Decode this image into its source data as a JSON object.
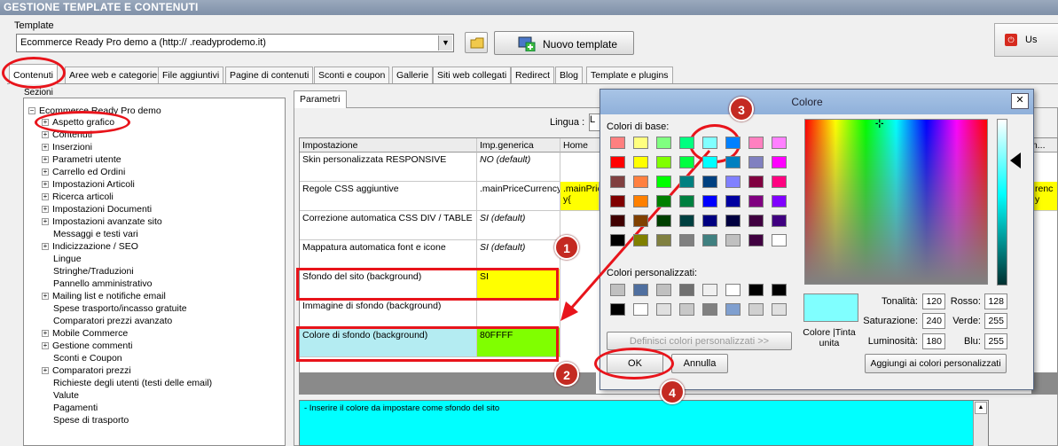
{
  "window": {
    "title": "GESTIONE TEMPLATE E CONTENUTI"
  },
  "template": {
    "label": "Template",
    "selected": "Ecommerce Ready Pro demo a        (http://       .readyprodemo.it)",
    "new_button": "Nuovo template",
    "exit_label": "Us"
  },
  "tabs": [
    "Contenuti",
    "Aree web e categorie",
    "File aggiuntivi",
    "Pagine di contenuti",
    "Sconti e coupon",
    "Gallerie",
    "Siti web collegati",
    "Redirect",
    "Blog",
    "Template e plugins"
  ],
  "sidebar": {
    "section_label": "Sezioni",
    "root": "Ecommerce Ready Pro demo",
    "items": [
      "Aspetto grafico",
      "Contenuti",
      "Inserzioni",
      "Parametri utente",
      "Carrello ed Ordini",
      "Impostazioni Articoli",
      "Ricerca articoli",
      "Impostazioni Documenti",
      "Impostazioni avanzate sito",
      "Messaggi e testi vari",
      "Indicizzazione / SEO",
      "Lingue",
      "Stringhe/Traduzioni",
      "Pannello amministrativo",
      "Mailing list e notifiche email",
      "Spese trasporto/incasso gratuite",
      "Comparatori prezzi avanzato",
      "Mobile Commerce",
      "Gestione commenti",
      "Sconti e Coupon",
      "Comparatori prezzi",
      "Richieste degli utenti (testi delle email)",
      "Valute",
      "Pagamenti",
      "Spese di trasporto"
    ]
  },
  "params": {
    "tab": "Parametri",
    "lingua_label": "Lingua :",
    "lingua_value": "L",
    "headers": [
      "Impostazione",
      "Imp.generica",
      "Home"
    ],
    "last_header": "m...",
    "rows": [
      {
        "name": "Skin personalizzata RESPONSIVE",
        "value": "NO (default)"
      },
      {
        "name": "Regole CSS aggiuntive",
        "value": ".mainPriceCurrency{",
        "home": ".mainPric y{"
      },
      {
        "name": "Correzione automatica CSS DIV / TABLE",
        "value": "SI (default)"
      },
      {
        "name": "Mappatura automatica font e icone",
        "value": "SI (default)"
      },
      {
        "name": "Sfondo del sito (background)",
        "value": "SI"
      },
      {
        "name": "Immagine di sfondo (background)",
        "value": ""
      },
      {
        "name": "Colore di sfondo (background)",
        "value": "80FFFF"
      }
    ],
    "right_fragment": "renc y",
    "description": "- Inserire il colore da impostare come sfondo del sito"
  },
  "color_dialog": {
    "title": "Colore",
    "basic_label": "Colori di base:",
    "custom_label": "Colori personalizzati:",
    "define_button": "Definisci colori personalizzati >>",
    "ok": "OK",
    "cancel": "Annulla",
    "preview_label": "Colore |Tinta unita",
    "add_button": "Aggiungi ai colori personalizzati",
    "fields": {
      "hue_label": "Tonalità:",
      "hue": "120",
      "sat_label": "Saturazione:",
      "sat": "240",
      "lum_label": "Luminosità:",
      "lum": "180",
      "red_label": "Rosso:",
      "red": "128",
      "green_label": "Verde:",
      "green": "255",
      "blue_label": "Blu:",
      "blue": "255"
    },
    "basic_colors": [
      "#ff8080",
      "#ffff80",
      "#80ff80",
      "#00ff80",
      "#80ffff",
      "#0080ff",
      "#ff80c0",
      "#ff80ff",
      "#ff0000",
      "#ffff00",
      "#80ff00",
      "#00ff40",
      "#00ffff",
      "#0080c0",
      "#8080c0",
      "#ff00ff",
      "#804040",
      "#ff8040",
      "#00ff00",
      "#008080",
      "#004080",
      "#8080ff",
      "#800040",
      "#ff0080",
      "#800000",
      "#ff8000",
      "#008000",
      "#008040",
      "#0000ff",
      "#0000a0",
      "#800080",
      "#8000ff",
      "#400000",
      "#804000",
      "#004000",
      "#004040",
      "#000080",
      "#000040",
      "#400040",
      "#400080",
      "#000000",
      "#808000",
      "#808040",
      "#808080",
      "#408080",
      "#c0c0c0",
      "#400040",
      "#ffffff"
    ],
    "custom_colors": [
      "#c0c0c0",
      "#4f6f9f",
      "#c0c0c0",
      "#707070",
      "#f0f0f0",
      "#ffffff",
      "#000000",
      "#000000",
      "#000000",
      "#ffffff",
      "#e0e0e0",
      "#c8c8c8",
      "#808080",
      "#7f9fcf",
      "#d0d0d0",
      "#e0e0e0"
    ]
  },
  "callouts": [
    "1",
    "2",
    "3",
    "4"
  ]
}
